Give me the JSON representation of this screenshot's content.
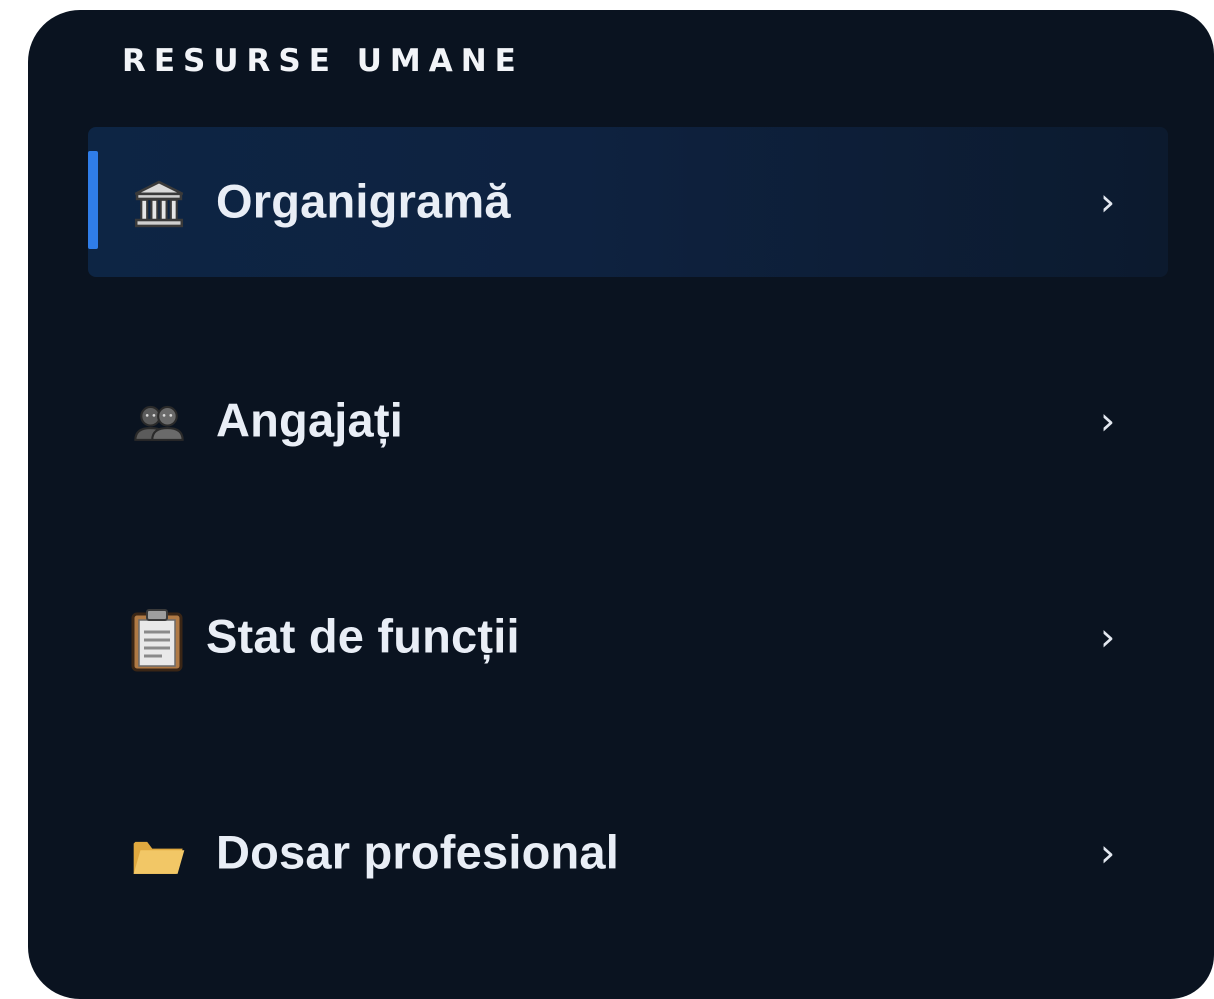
{
  "section": {
    "title": "RESURSE UMANE"
  },
  "menu": {
    "items": [
      {
        "label": "Organigramă",
        "icon": "classical-building-icon",
        "active": true,
        "chevron": "›"
      },
      {
        "label": "Angajați",
        "icon": "busts-in-silhouette-icon",
        "active": false,
        "chevron": "›"
      },
      {
        "label": "Stat de funcții",
        "icon": "clipboard-icon",
        "active": false,
        "chevron": "›"
      },
      {
        "label": "Dosar profesional",
        "icon": "folder-icon",
        "active": false,
        "chevron": "›"
      }
    ]
  },
  "colors": {
    "panel_background": "#0a1320",
    "active_background": "#0d2544",
    "active_indicator": "#2f7de8",
    "text": "#e9eef6"
  }
}
